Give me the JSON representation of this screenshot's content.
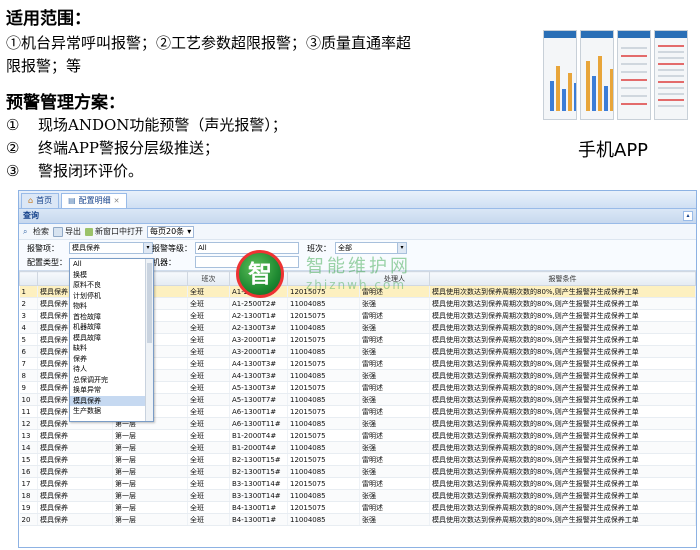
{
  "slide": {
    "scope_title": "适用范围：",
    "scope_line1": "①机台异常呼叫报警；②工艺参数超限报警；③质量直通率超",
    "scope_line2": "限报警；等",
    "plan_title": "预警管理方案：",
    "plan_items": [
      {
        "num": "①",
        "text": "现场ANDON功能预警（声光报警）；"
      },
      {
        "num": "②",
        "text": "终端APP警报分层级推送；"
      },
      {
        "num": "③",
        "text": "警报闭环评价。"
      }
    ],
    "app_label": "手机APP"
  },
  "app": {
    "tabs": [
      {
        "label": "首页",
        "icon": "home-icon"
      },
      {
        "label": "配置明细",
        "icon": "document-icon"
      }
    ],
    "panel_title": "查询",
    "toolbar": {
      "search": "检索",
      "export": "导出",
      "new_window": "新窗口中打开",
      "page_size": "每页20条"
    },
    "filters": {
      "type_label": "报警项：",
      "type_value": "模具保养",
      "level_label": "报警等级：",
      "level_value": "All",
      "shift_label": "班次：",
      "shift_value": "全部",
      "config_label": "配置类型：",
      "machine_label": "机器："
    },
    "dropdown_options": [
      "All",
      "换模",
      "原料不良",
      "计划停机",
      "物料",
      "首检故障",
      "机器故障",
      "模具故障",
      "缺料",
      "保养",
      "待人",
      "总保调开完",
      "换单异常",
      "模具保养",
      "生产数据"
    ],
    "dropdown_highlight": "模具保养",
    "columns": [
      "",
      "",
      "",
      "班次",
      "机台",
      "",
      "处理人",
      "报警条件"
    ],
    "rows": [
      [
        "1",
        "模具保养",
        "",
        "全班",
        "A1-2500T1#",
        "12015075",
        "雷明述",
        "模具使用次数达到保养周期次数的80%,则产生报警并生成保养工单"
      ],
      [
        "2",
        "模具保养",
        "",
        "全班",
        "A1-2500T2#",
        "11004085",
        "张强",
        "模具使用次数达到保养周期次数的80%,则产生报警并生成保养工单"
      ],
      [
        "3",
        "模具保养",
        "",
        "全班",
        "A2-1300T1#",
        "12015075",
        "雷明述",
        "模具使用次数达到保养周期次数的80%,则产生报警并生成保养工单"
      ],
      [
        "4",
        "模具保养",
        "",
        "全班",
        "A2-1300T3#",
        "11004085",
        "张强",
        "模具使用次数达到保养周期次数的80%,则产生报警并生成保养工单"
      ],
      [
        "5",
        "模具保养",
        "",
        "全班",
        "A3-2000T1#",
        "12015075",
        "雷明述",
        "模具使用次数达到保养周期次数的80%,则产生报警并生成保养工单"
      ],
      [
        "6",
        "模具保养",
        "",
        "全班",
        "A3-2000T1#",
        "11004085",
        "张强",
        "模具使用次数达到保养周期次数的80%,则产生报警并生成保养工单"
      ],
      [
        "7",
        "模具保养",
        "",
        "全班",
        "A4-1300T3#",
        "12015075",
        "雷明述",
        "模具使用次数达到保养周期次数的80%,则产生报警并生成保养工单"
      ],
      [
        "8",
        "模具保养",
        "",
        "全班",
        "A4-1300T3#",
        "11004085",
        "张强",
        "模具使用次数达到保养周期次数的80%,则产生报警并生成保养工单"
      ],
      [
        "9",
        "模具保养",
        "",
        "全班",
        "A5-1300T3#",
        "12015075",
        "雷明述",
        "模具使用次数达到保养周期次数的80%,则产生报警并生成保养工单"
      ],
      [
        "10",
        "模具保养",
        "",
        "全班",
        "A5-1300T7#",
        "11004085",
        "张强",
        "模具使用次数达到保养周期次数的80%,则产生报警并生成保养工单"
      ],
      [
        "11",
        "模具保养",
        "第一层",
        "全班",
        "A6-1300T1#",
        "12015075",
        "雷明述",
        "模具使用次数达到保养周期次数的80%,则产生报警并生成保养工单"
      ],
      [
        "12",
        "模具保养",
        "第一层",
        "全班",
        "A6-1300T11#",
        "11004085",
        "张强",
        "模具使用次数达到保养周期次数的80%,则产生报警并生成保养工单"
      ],
      [
        "13",
        "模具保养",
        "第一层",
        "全班",
        "B1-2000T4#",
        "12015075",
        "雷明述",
        "模具使用次数达到保养周期次数的80%,则产生报警并生成保养工单"
      ],
      [
        "14",
        "模具保养",
        "第一层",
        "全班",
        "B1-2000T4#",
        "11004085",
        "张强",
        "模具使用次数达到保养周期次数的80%,则产生报警并生成保养工单"
      ],
      [
        "15",
        "模具保养",
        "第一层",
        "全班",
        "B2-1300T15#",
        "12015075",
        "雷明述",
        "模具使用次数达到保养周期次数的80%,则产生报警并生成保养工单"
      ],
      [
        "16",
        "模具保养",
        "第一层",
        "全班",
        "B2-1300T15#",
        "11004085",
        "张强",
        "模具使用次数达到保养周期次数的80%,则产生报警并生成保养工单"
      ],
      [
        "17",
        "模具保养",
        "第一层",
        "全班",
        "B3-1300T14#",
        "12015075",
        "雷明述",
        "模具使用次数达到保养周期次数的80%,则产生报警并生成保养工单"
      ],
      [
        "18",
        "模具保养",
        "第一层",
        "全班",
        "B3-1300T14#",
        "11004085",
        "张强",
        "模具使用次数达到保养周期次数的80%,则产生报警并生成保养工单"
      ],
      [
        "19",
        "模具保养",
        "第一层",
        "全班",
        "B4-1300T1#",
        "12015075",
        "雷明述",
        "模具使用次数达到保养周期次数的80%,则产生报警并生成保养工单"
      ],
      [
        "20",
        "模具保养",
        "第一层",
        "全班",
        "B4-1300T1#",
        "11004085",
        "张强",
        "模具使用次数达到保养周期次数的80%,则产生报警并生成保养工单"
      ]
    ],
    "selected_row": 1
  },
  "watermark": {
    "logo_char": "智",
    "text": "智能维护网",
    "url": "zhiznwh.com"
  },
  "colors": {
    "accent": "#15428b",
    "selected_row": "#fdf0c0",
    "border": "#99bbe8"
  }
}
